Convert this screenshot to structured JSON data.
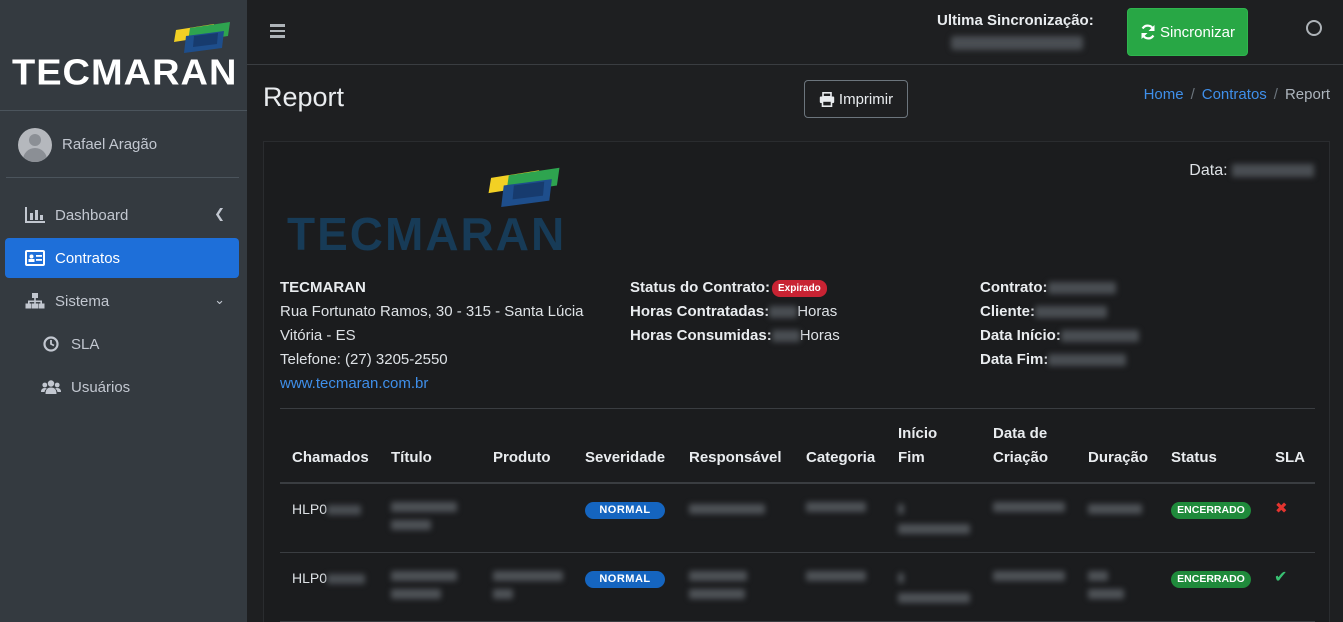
{
  "brand": {
    "name": "TECMARAN",
    "colors": {
      "green": "#2ea44f",
      "yellow": "#f2d024",
      "blue": "#1e4e8c"
    }
  },
  "sidebar": {
    "user": "Rafael Aragão",
    "items": [
      {
        "label": "Dashboard",
        "icon": "bar-chart-icon",
        "active": false
      },
      {
        "label": "Contratos",
        "icon": "id-card-icon",
        "active": true
      },
      {
        "label": "Sistema",
        "icon": "sitemap-icon",
        "active": false
      },
      {
        "label": "SLA",
        "icon": "clock-icon",
        "active": false
      },
      {
        "label": "Usuários",
        "icon": "users-icon",
        "active": false
      }
    ]
  },
  "topbar": {
    "sync_label": "Ultima Sincronização:",
    "sync_button": "Sincronizar"
  },
  "header": {
    "title": "Report",
    "print_button": "Imprimir",
    "breadcrumb": {
      "home": "Home",
      "contratos": "Contratos",
      "current": "Report",
      "sep": "/"
    }
  },
  "report": {
    "date_label": "Data:",
    "company": {
      "name": "TECMARAN",
      "address": "Rua Fortunato Ramos, 30 - 315 - Santa Lúcia",
      "city": "Vitória - ES",
      "phone": "Telefone: (27) 3205-2550",
      "website": "www.tecmaran.com.br"
    },
    "status": {
      "status_label": "Status do Contrato:",
      "status_value": "Expirado",
      "hours_contracted_label": "Horas Contratadas:",
      "hours_consumed_label": "Horas Consumidas:",
      "hours_unit": "Horas"
    },
    "contract": {
      "contract_label": "Contrato:",
      "client_label": "Cliente:",
      "start_label": "Data Início:",
      "end_label": "Data Fim:"
    },
    "table": {
      "headers": {
        "chamados": "Chamados",
        "titulo": "Título",
        "produto": "Produto",
        "severidade": "Severidade",
        "responsavel": "Responsável",
        "categoria": "Categoria",
        "inicio": "Início",
        "fim": "Fim",
        "data_de": "Data de",
        "criacao": "Criação",
        "duracao": "Duração",
        "status": "Status",
        "sla": "SLA"
      },
      "rows": [
        {
          "id": "HLP0",
          "severity": "NORMAL",
          "status": "ENCERRADO",
          "sla": "fail"
        },
        {
          "id": "HLP0",
          "severity": "NORMAL",
          "status": "ENCERRADO",
          "sla": "ok"
        }
      ]
    }
  }
}
